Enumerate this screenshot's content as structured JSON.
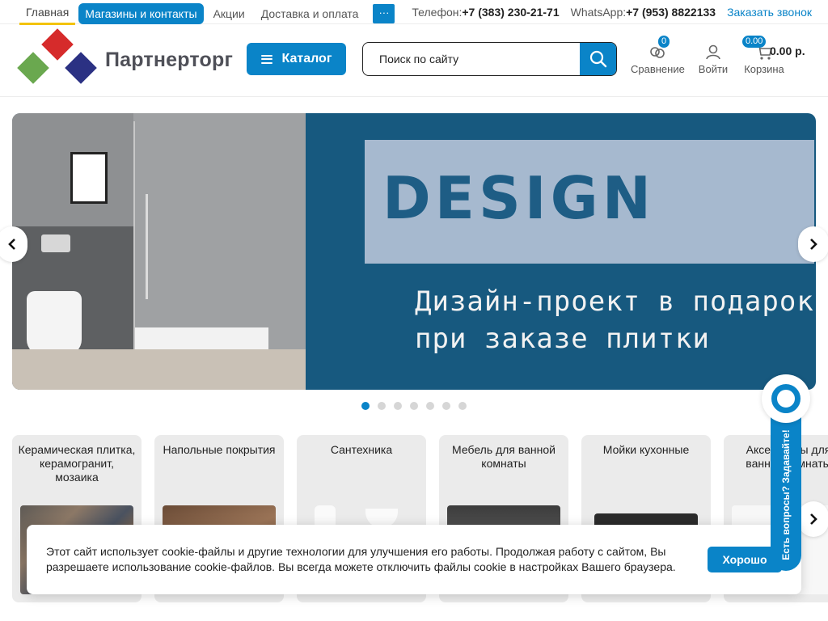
{
  "topnav": {
    "items": [
      "Главная",
      "Магазины и контакты",
      "Акции",
      "Доставка и оплата"
    ],
    "more": "···"
  },
  "contacts": {
    "phone_label": "Телефон:",
    "phone": "+7 (383) 230-21-71",
    "whatsapp_label": "WhatsApp:",
    "whatsapp": "+7 (953) 8822133",
    "callback": "Заказать звонок"
  },
  "header": {
    "brand": "Партнерторг",
    "catalog_label": "Каталог",
    "search_placeholder": "Поиск по сайту",
    "compare_label": "Сравнение",
    "compare_count": "0",
    "login_label": "Войти",
    "cart_label": "Корзина",
    "cart_count": "0.00",
    "cart_sum": "0.00 р."
  },
  "banner": {
    "logo_text": "DESIGN",
    "line1": "Дизайн-проект в подарок",
    "line2": "при заказе плитки",
    "slides_total": 7,
    "active_slide": 1
  },
  "categories": [
    {
      "title": "Керамическая плитка, керамогранит, мозаика"
    },
    {
      "title": "Напольные покрытия"
    },
    {
      "title": "Сантехника"
    },
    {
      "title": "Мебель для ванной комнаты"
    },
    {
      "title": "Мойки кухонные"
    },
    {
      "title": "Аксессуары для ванной комнаты"
    }
  ],
  "cookie": {
    "text": "Этот сайт использует cookie-файлы и другие технологии для улучшения его работы. Продолжая работу с сайтом, Вы разрешаете использование cookie-файлов. Вы всегда можете отключить файлы cookie в настройках Вашего браузера.",
    "ok": "Хорошо"
  },
  "chat": {
    "label": "Есть вопросы? Задавайте!"
  },
  "colors": {
    "accent": "#0a84c8",
    "banner_bg": "#17597f",
    "logo_red": "#d62b2b",
    "logo_green": "#6aa84f",
    "logo_navy": "#2b3183",
    "home_underline": "#f3c300"
  }
}
